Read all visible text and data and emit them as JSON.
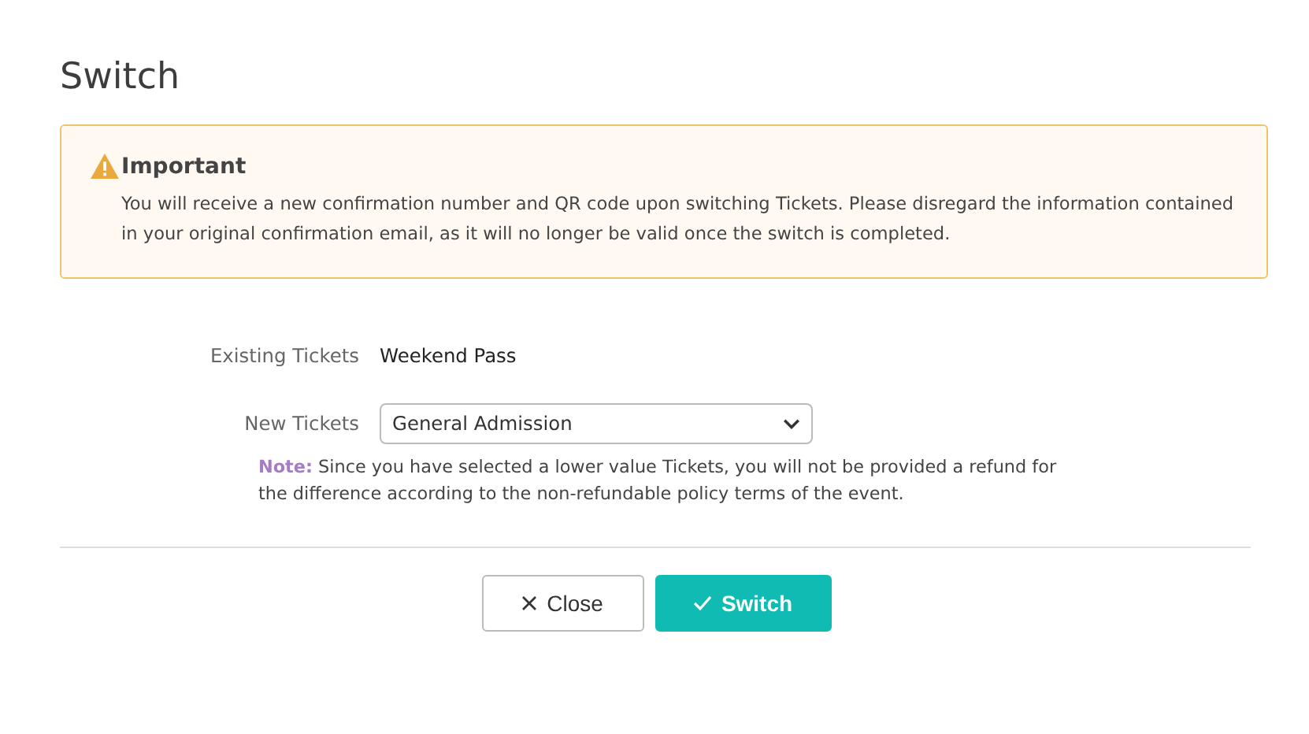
{
  "dialog": {
    "title": "Switch"
  },
  "alert": {
    "title": "Important",
    "message": "You will receive a new confirmation number and QR code upon switching Tickets. Please disregard the information contained in your original confirmation email, as it will no longer be valid once the switch is completed."
  },
  "existing_tickets": {
    "label": "Existing Tickets",
    "value": "Weekend Pass"
  },
  "new_tickets": {
    "label": "New Tickets",
    "value": "General Admission"
  },
  "note": {
    "label": "Note:",
    "text": "Since you have selected a lower value Tickets, you will not be provided a refund for the difference according to the non-refundable policy terms of the event."
  },
  "buttons": [
    {
      "kind": "close",
      "label": "Close"
    },
    {
      "kind": "switch",
      "label": "Switch"
    }
  ]
}
